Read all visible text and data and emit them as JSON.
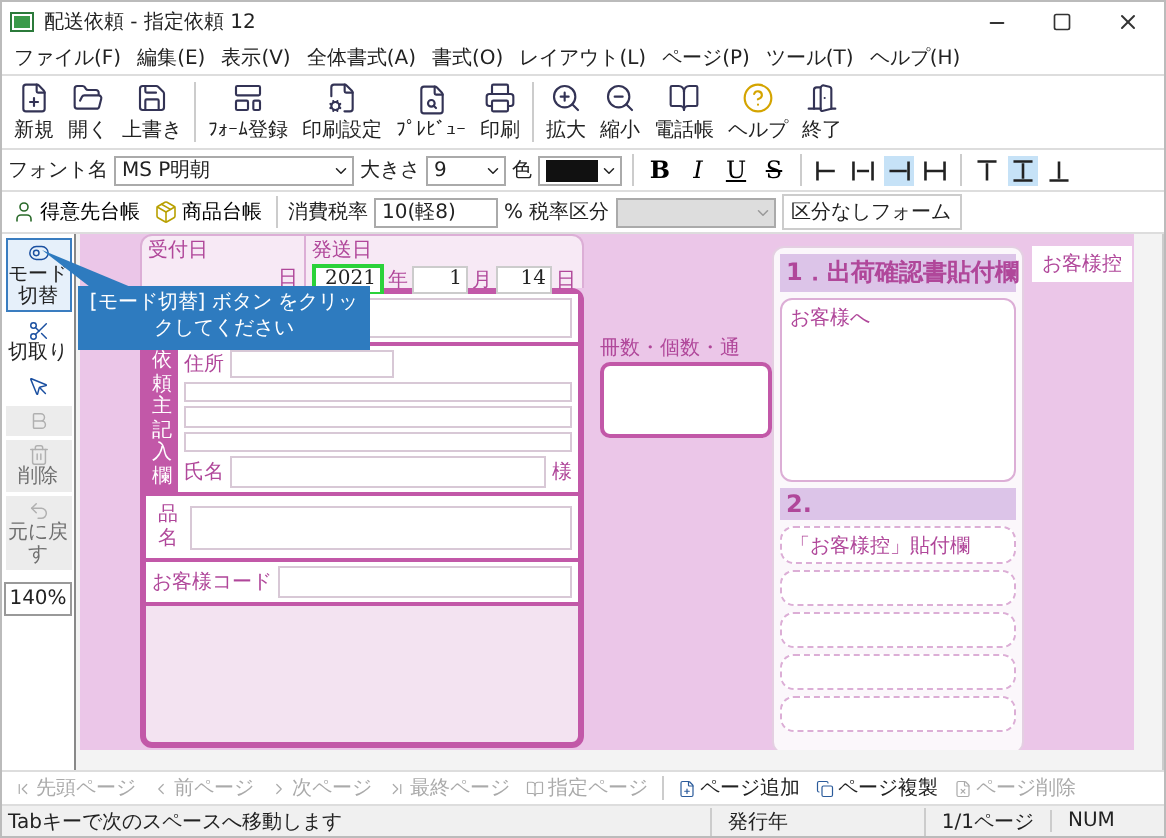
{
  "window": {
    "title": "配送依頼 - 指定依頼 12"
  },
  "menu": [
    "ファイル(F)",
    "編集(E)",
    "表示(V)",
    "全体書式(A)",
    "書式(O)",
    "レイアウト(L)",
    "ページ(P)",
    "ツール(T)",
    "ヘルプ(H)"
  ],
  "toolbar": [
    {
      "label": "新規"
    },
    {
      "label": "開く"
    },
    {
      "label": "上書き"
    },
    {
      "label": "ﾌｫｰﾑ登録"
    },
    {
      "label": "印刷設定"
    },
    {
      "label": "ﾌﾟﾚﾋﾞｭｰ"
    },
    {
      "label": "印刷"
    },
    {
      "label": "拡大"
    },
    {
      "label": "縮小"
    },
    {
      "label": "電話帳"
    },
    {
      "label": "ヘルプ"
    },
    {
      "label": "終了"
    }
  ],
  "format_bar": {
    "font_label": "フォント名",
    "font_value": "MS P明朝",
    "size_label": "大きさ",
    "size_value": "9",
    "color_label": "色",
    "styles": [
      {
        "label": "B",
        "kind": "bold"
      },
      {
        "label": "I",
        "kind": "italic"
      },
      {
        "label": "U",
        "kind": "underline"
      },
      {
        "label": "S",
        "kind": "strike"
      }
    ],
    "aligns": [
      {
        "kind": "left",
        "selected": false
      },
      {
        "kind": "center",
        "selected": false
      },
      {
        "kind": "right",
        "selected": true
      },
      {
        "kind": "justify",
        "selected": false
      },
      {
        "kind": "top",
        "selected": false
      },
      {
        "kind": "middle",
        "selected": true
      },
      {
        "kind": "bottom",
        "selected": false
      }
    ]
  },
  "ledger_bar": {
    "buttons": [
      {
        "label": "得意先台帳",
        "kind": "person"
      },
      {
        "label": "商品台帳",
        "kind": "box"
      }
    ],
    "tax_label": "消費税率",
    "tax_value": "10(軽8)",
    "tax_unit": "%",
    "category_label": "税率区分",
    "category_disabled": true,
    "form_label": "区分なしフォーム"
  },
  "sidebar": {
    "items": [
      {
        "kind": "labeled",
        "label": "モード切替",
        "selected": true,
        "disabled": false
      },
      {
        "kind": "labeled",
        "label": "切取り",
        "selected": false,
        "disabled": false
      },
      {
        "kind": "icon",
        "selected": false,
        "disabled": false
      },
      {
        "kind": "icon",
        "selected": false,
        "disabled": true
      },
      {
        "kind": "labeled",
        "label": "削除",
        "selected": false,
        "disabled": true
      },
      {
        "kind": "labeled",
        "label": "元に戻す",
        "selected": false,
        "disabled": true
      }
    ],
    "zoom": "140%"
  },
  "tooltip": "[モード切替] ボタン をクリックしてください",
  "form": {
    "received_label": "受付日",
    "received_day_unit": "日",
    "ship_label": "発送日",
    "year_field": {
      "value": "2021",
      "focused": true
    },
    "year_unit": "年",
    "month": "1",
    "month_unit": "月",
    "day": "14",
    "day_unit": "日",
    "sender_heading": "依頼主記入欄",
    "address_label": "住所",
    "name_label": "氏名",
    "honorific": "様",
    "item_label": "品名",
    "customer_code_label": "お客様コード",
    "count_label": "冊数・個数・通",
    "section_1": "1．出荷確認書貼付欄",
    "section_1_note": "お客様へ",
    "section_2": "2.",
    "stub_label": "「お客様控」貼付欄",
    "tag": "お客様控"
  },
  "page_nav": [
    {
      "kind": "first",
      "label": "先頭ページ",
      "disabled": true
    },
    {
      "kind": "prev",
      "label": "前ページ",
      "disabled": true
    },
    {
      "kind": "next",
      "label": "次ページ",
      "disabled": true
    },
    {
      "kind": "last",
      "label": "最終ページ",
      "disabled": true
    },
    {
      "kind": "goto",
      "label": "指定ページ",
      "disabled": true
    },
    {
      "kind": "add",
      "label": "ページ追加",
      "disabled": false
    },
    {
      "kind": "copy",
      "label": "ページ複製",
      "disabled": false
    },
    {
      "kind": "delete",
      "label": "ページ削除",
      "disabled": true
    }
  ],
  "status_bar": {
    "message": "Tabキーで次のスペースへ移動します",
    "fields": [
      "発行年",
      "1/1ページ",
      "NUM"
    ]
  }
}
